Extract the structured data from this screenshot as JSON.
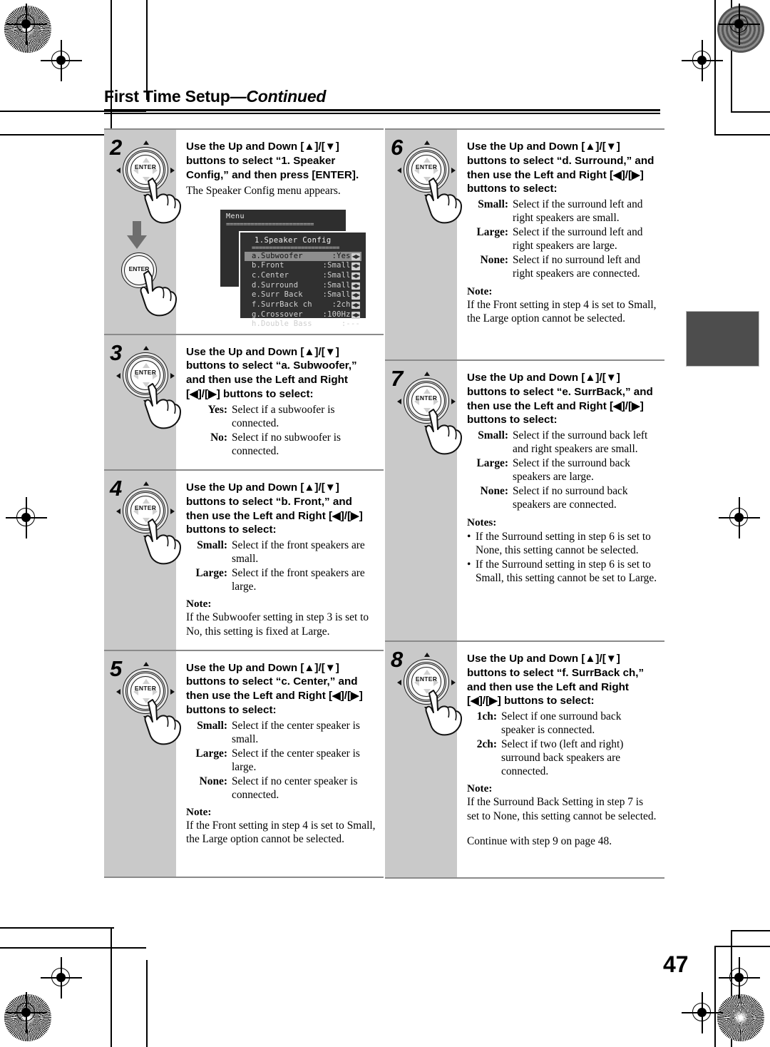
{
  "header": {
    "title_bold": "First Time Setup",
    "title_italic": "—Continued"
  },
  "page_number": "47",
  "osd": {
    "outer_title": "Menu",
    "separator": "=========================",
    "inner_title": "1.Speaker Config",
    "rows": [
      {
        "label": "a.Subwoofer",
        "value": ":Yes",
        "adjust": "◀▶",
        "selected": true
      },
      {
        "label": "b.Front",
        "value": ":Small",
        "adjust": "◀▶",
        "selected": false
      },
      {
        "label": "c.Center",
        "value": ":Small",
        "adjust": "◀▶",
        "selected": false
      },
      {
        "label": "d.Surround",
        "value": ":Small",
        "adjust": "◀▶",
        "selected": false
      },
      {
        "label": "e.Surr Back",
        "value": ":Small",
        "adjust": "◀▶",
        "selected": false
      },
      {
        "label": "f.SurrBack ch",
        "value": ":2ch",
        "adjust": "◀▶",
        "selected": false
      },
      {
        "label": "g.Crossover",
        "value": ":100Hz",
        "adjust": "◀▶",
        "selected": false
      },
      {
        "label": "h.Double Bass",
        "value": ":---",
        "adjust": "",
        "selected": false
      }
    ]
  },
  "dial": {
    "enter_label": "ENTER"
  },
  "steps": {
    "s2": {
      "num": "2",
      "lead_a": "Use the Up and Down [",
      "lead_up": "▲",
      "lead_b": "]/[",
      "lead_dn": "▼",
      "lead_c": "] buttons to select “1. Speaker Config,” and then press [ENTER].",
      "sub": "The Speaker Config menu appears."
    },
    "s3": {
      "num": "3",
      "lead": "Use the Up and Down [▲]/[▼] buttons to select “a. Subwoofer,” and then use the Left and Right [◀]/[▶] buttons to select:",
      "defs": [
        {
          "key": "Yes:",
          "val": "Select if a subwoofer is connected."
        },
        {
          "key": "No:",
          "val": "Select if no subwoofer is connected."
        }
      ]
    },
    "s4": {
      "num": "4",
      "lead": "Use the Up and Down [▲]/[▼] buttons to select “b. Front,” and then use the Left and Right [◀]/[▶] buttons to select:",
      "defs": [
        {
          "key": "Small:",
          "val": "Select if the front speakers are small."
        },
        {
          "key": "Large:",
          "val": "Select if the front speakers are large."
        }
      ],
      "note_heading": "Note:",
      "note_text": "If the Subwoofer setting in step 3 is set to No, this setting is fixed at Large."
    },
    "s5": {
      "num": "5",
      "lead": "Use the Up and Down [▲]/[▼] buttons to select “c. Center,” and then use the Left and Right [◀]/[▶] buttons to select:",
      "defs": [
        {
          "key": "Small:",
          "val": "Select if the center speaker is small."
        },
        {
          "key": "Large:",
          "val": "Select if the center speaker is large."
        },
        {
          "key": "None:",
          "val": "Select if no center speaker is connected."
        }
      ],
      "note_heading": "Note:",
      "note_text": "If the Front setting in step 4 is set to Small, the Large option cannot be selected."
    },
    "s6": {
      "num": "6",
      "lead": "Use the Up and Down [▲]/[▼] buttons to select “d. Surround,” and then use the Left and Right [◀]/[▶] buttons to select:",
      "defs": [
        {
          "key": "Small:",
          "val": "Select if the surround left and right speakers are small."
        },
        {
          "key": "Large:",
          "val": "Select if the surround left and right speakers are large."
        },
        {
          "key": "None:",
          "val": "Select if no surround left and right speakers are connected."
        }
      ],
      "note_heading": "Note:",
      "note_text": "If the Front setting in step 4 is set to Small, the Large option cannot be selected."
    },
    "s7": {
      "num": "7",
      "lead": "Use the Up and Down [▲]/[▼] buttons to select “e. SurrBack,” and then use the Left and Right [◀]/[▶] buttons to select:",
      "defs": [
        {
          "key": "Small:",
          "val": "Select if the surround back left and right speakers are small."
        },
        {
          "key": "Large:",
          "val": "Select if the surround back speakers are large."
        },
        {
          "key": "None:",
          "val": "Select if no surround back speakers are connected."
        }
      ],
      "note_heading": "Notes:",
      "bullets": [
        "If the Surround setting in step 6 is set to None, this setting cannot be selected.",
        "If the Surround setting in step 6 is set to Small, this setting cannot be set to Large."
      ],
      "bullet_mark": "•"
    },
    "s8": {
      "num": "8",
      "lead": "Use the Up and Down [▲]/[▼] buttons to select “f. SurrBack ch,” and then use the Left and Right [◀]/[▶] buttons to select:",
      "defs": [
        {
          "key": "1ch:",
          "val": "Select if one surround back speaker is connected."
        },
        {
          "key": "2ch:",
          "val": "Select if two (left and right) surround back speakers are connected."
        }
      ],
      "note_heading": "Note:",
      "note_text": "If the Surround Back Setting in step 7 is set to None, this setting cannot be selected.",
      "continue_text": "Continue with step 9 on page 48."
    }
  }
}
